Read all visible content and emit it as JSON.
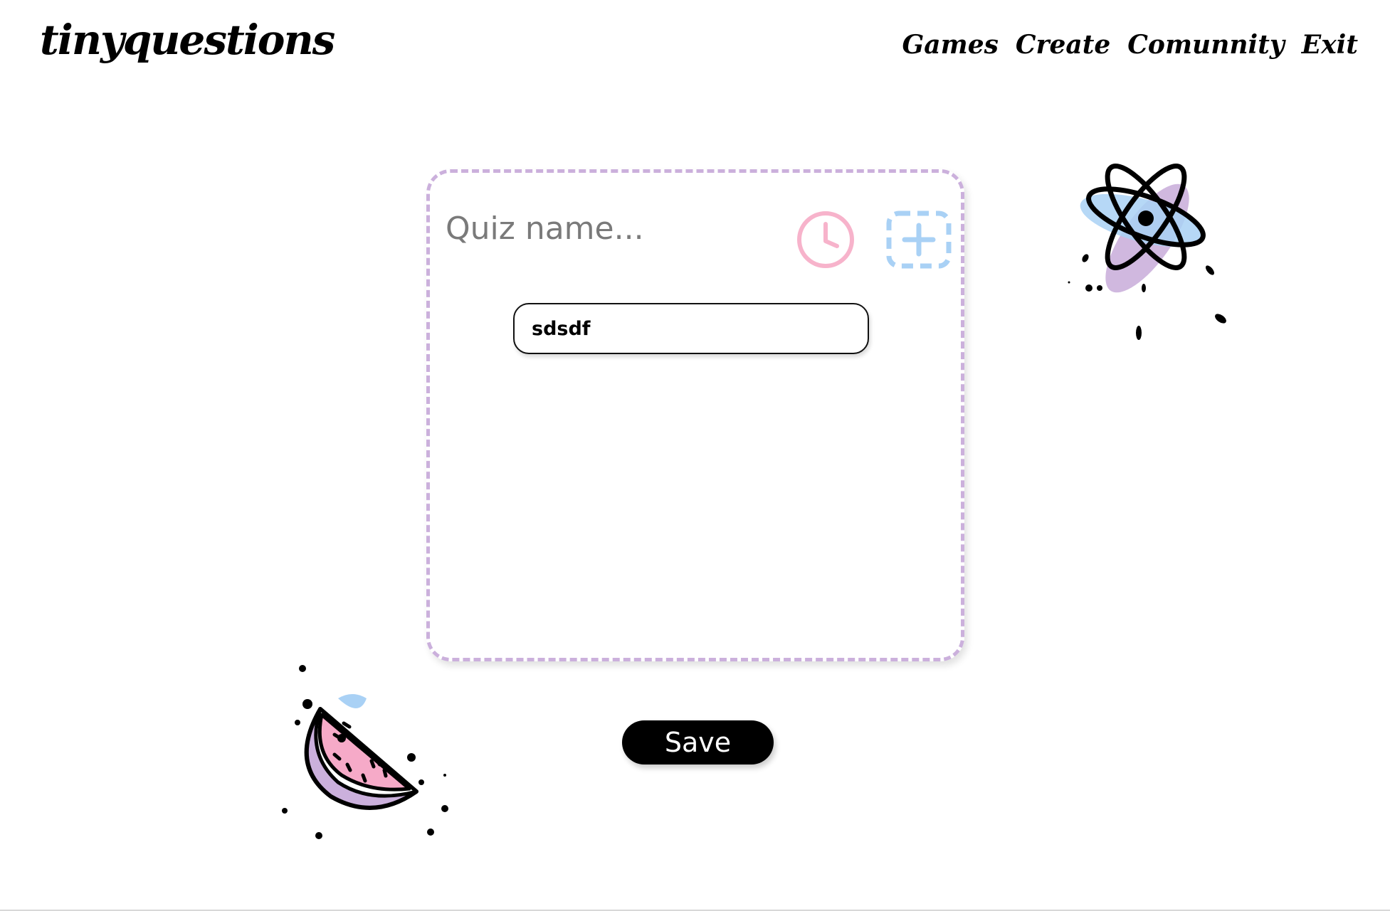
{
  "header": {
    "logo": "tinyquestions",
    "nav": [
      "Games",
      "Create",
      "Comunnity",
      "Exit"
    ]
  },
  "quiz": {
    "name_placeholder": "Quiz name...",
    "question_value": "sdsdf"
  },
  "actions": {
    "save_label": "Save"
  },
  "icons": {
    "timer": "clock-icon",
    "add": "add-dashed-icon",
    "atom": "atom-illustration",
    "watermelon": "watermelon-illustration"
  },
  "colors": {
    "card_border": "#cbb0dc",
    "timer_icon": "#f7b3cb",
    "add_icon": "#a9d1f5",
    "button_bg": "#000000"
  }
}
